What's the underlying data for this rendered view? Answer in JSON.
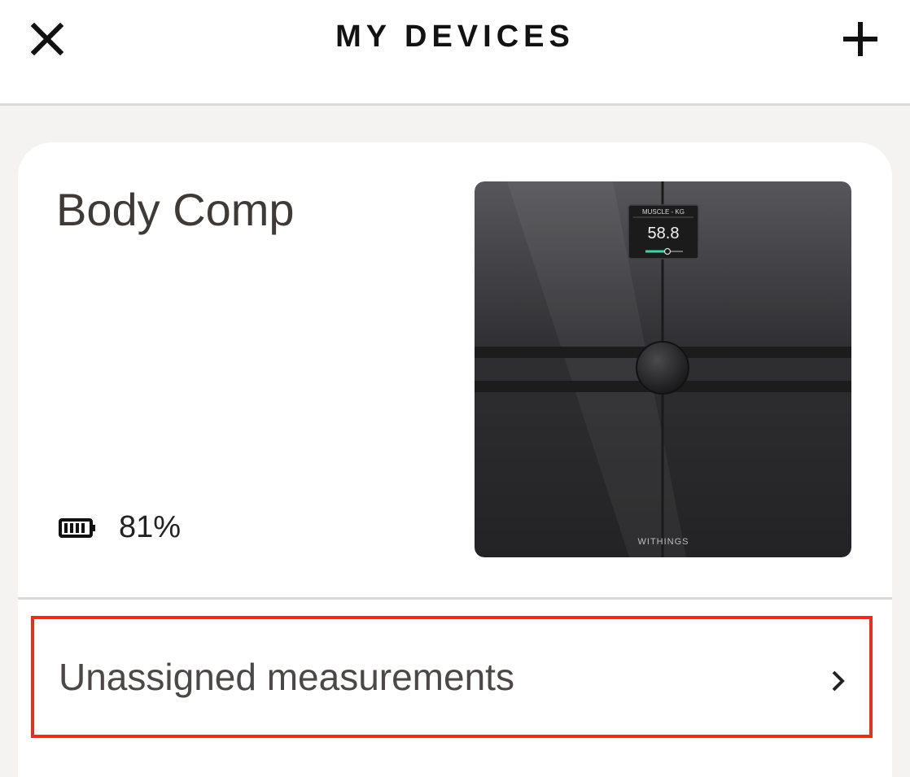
{
  "header": {
    "title": "MY DEVICES",
    "close_icon": "close-icon",
    "add_icon": "plus-icon"
  },
  "device": {
    "name": "Body Comp",
    "battery_level": 81,
    "battery_text": "81%",
    "battery_icon": "battery-icon",
    "image": {
      "display_label": "MUSCLE - KG",
      "display_value": "58.8",
      "brand": "WITHINGS"
    }
  },
  "menu": {
    "unassigned_label": "Unassigned measurements",
    "chevron_icon": "chevron-right-icon"
  },
  "colors": {
    "highlight": "#e0321f",
    "background": "#f4f3f1",
    "card": "#ffffff",
    "scale_body": "#2a2a2c"
  }
}
